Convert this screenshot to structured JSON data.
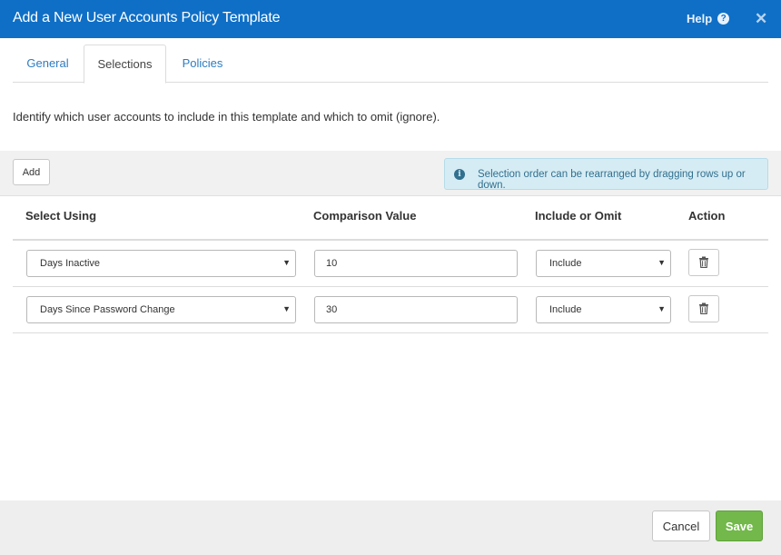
{
  "dialog": {
    "title": "Add a New User Accounts Policy Template",
    "help_label": "Help",
    "help_icon": "question-circle-icon",
    "close_icon": "close-x-icon",
    "accent_color": "#0f6fc6"
  },
  "tabs": [
    {
      "label": "General",
      "active": false
    },
    {
      "label": "Selections",
      "active": true
    },
    {
      "label": "Policies",
      "active": false
    }
  ],
  "intro_text": "Identify which user accounts to include in this template and which to omit (ignore).",
  "toolbar": {
    "add_label": "Add",
    "info_text": "Selection order can be rearranged by dragging rows up or down.",
    "info_icon": "info-circle-icon"
  },
  "table": {
    "headers": [
      "Select Using",
      "Comparison Value",
      "Include or Omit",
      "Action"
    ],
    "rows": [
      {
        "select_using": "Days Inactive",
        "comparison_value": "10",
        "include_omit": "Include",
        "action_icon": "trash-icon"
      },
      {
        "select_using": "Days Since Password Change",
        "comparison_value": "30",
        "include_omit": "Include",
        "action_icon": "trash-icon"
      }
    ]
  },
  "footer": {
    "cancel_label": "Cancel",
    "save_label": "Save",
    "save_color": "#72b84a"
  }
}
